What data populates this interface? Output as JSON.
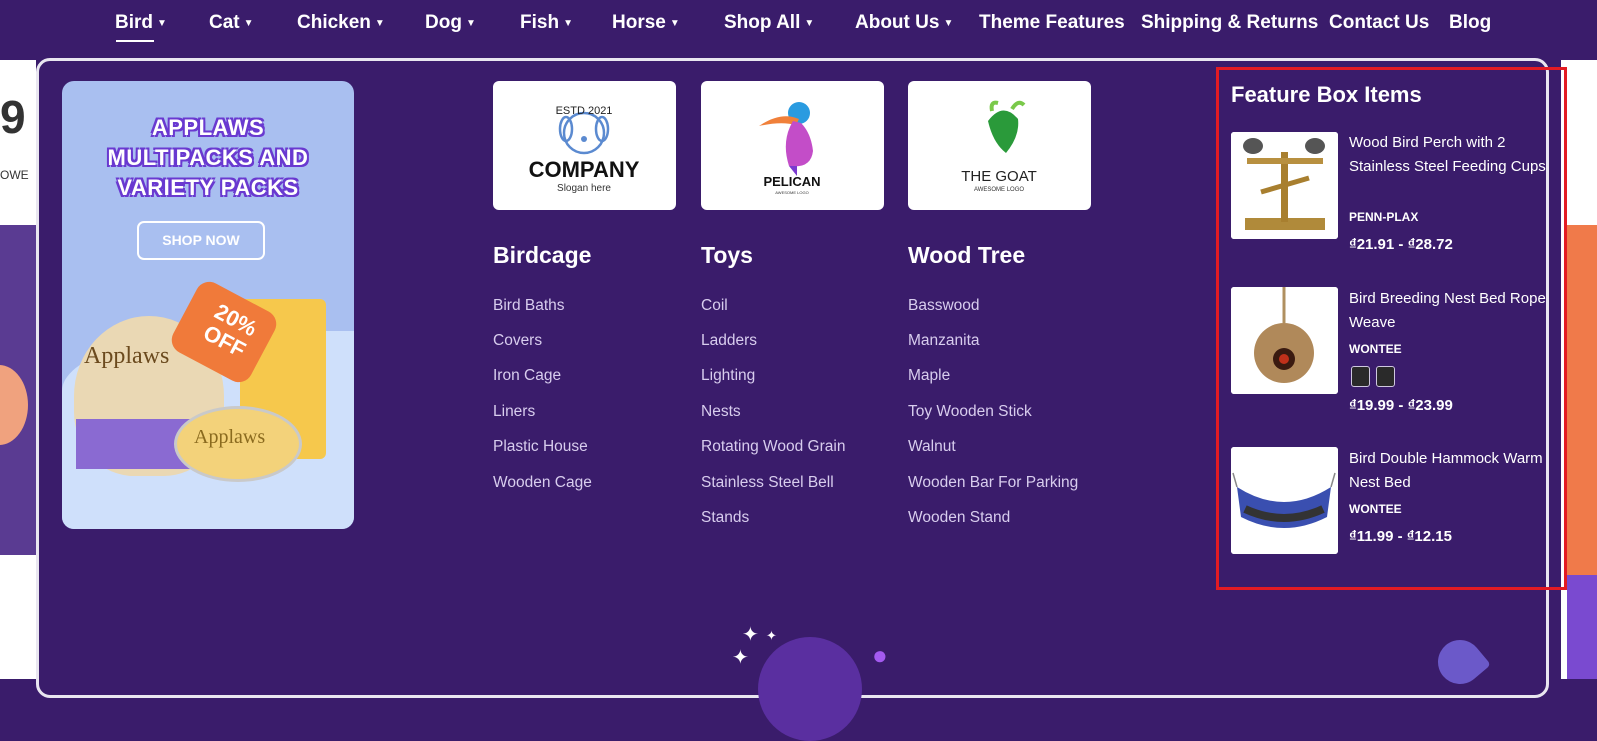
{
  "nav": {
    "items": [
      {
        "label": "Bird",
        "dropdown": true
      },
      {
        "label": "Cat",
        "dropdown": true
      },
      {
        "label": "Chicken",
        "dropdown": true
      },
      {
        "label": "Dog",
        "dropdown": true
      },
      {
        "label": "Fish",
        "dropdown": true
      },
      {
        "label": "Horse",
        "dropdown": true
      },
      {
        "label": "Shop All",
        "dropdown": true
      },
      {
        "label": "About Us",
        "dropdown": true
      },
      {
        "label": "Theme Features",
        "dropdown": false
      },
      {
        "label": "Shipping & Returns",
        "dropdown": false
      },
      {
        "label": "Contact Us",
        "dropdown": false
      },
      {
        "label": "Blog",
        "dropdown": false
      }
    ],
    "active": "Bird",
    "caret_icon": "chevron-down-icon"
  },
  "promo": {
    "headline_lines": [
      "APPLAWS",
      "MULTIPACKS AND",
      "VARIETY PACKS"
    ],
    "button_label": "SHOP NOW",
    "badge_lines": [
      "20%",
      "OFF"
    ],
    "product_brand": "Applaws"
  },
  "brands": [
    {
      "logo_top": "ESTD 2021",
      "name": "COMPANY",
      "tagline": "Slogan here"
    },
    {
      "name": "PELICAN",
      "tagline": "AWESOME LOGO"
    },
    {
      "name": "THE GOAT",
      "tagline": "AWESOME LOGO"
    }
  ],
  "columns": [
    {
      "title": "Birdcage",
      "links": [
        "Bird Baths",
        "Covers",
        "Iron Cage",
        "Liners",
        "Plastic House",
        "Wooden Cage"
      ]
    },
    {
      "title": "Toys",
      "links": [
        "Coil",
        "Ladders",
        "Lighting",
        "Nests",
        "Rotating Wood Grain",
        "Stainless Steel Bell",
        "Stands"
      ]
    },
    {
      "title": "Wood Tree",
      "links": [
        "Basswood",
        "Manzanita",
        "Maple",
        "Toy Wooden Stick",
        "Walnut",
        "Wooden Bar For Parking",
        "Wooden Stand"
      ]
    }
  ],
  "feature_box": {
    "title": "Feature Box Items",
    "items": [
      {
        "name": "Wood Bird Perch with 2 Stainless Steel Feeding Cups",
        "brand": "PENN-PLAX",
        "price": "₫21.91 - ₫28.72"
      },
      {
        "name": "Bird Breeding Nest Bed Rope Weave",
        "brand": "WONTEE",
        "price": "₫19.99 - ₫23.99",
        "swatches": 2
      },
      {
        "name": "Bird Double Hammock Warm Nest Bed",
        "brand": "WONTEE",
        "price": "₫11.99 - ₫12.15"
      }
    ]
  },
  "background": {
    "left_fragment": "9",
    "left_sub": "OWE"
  },
  "colors": {
    "nav_bg": "#3a1c6b",
    "panel_bg": "#3a1c6b",
    "highlight_border": "#e31b23",
    "promo_bg": "#a9bff0",
    "badge": "#f07a3a"
  }
}
